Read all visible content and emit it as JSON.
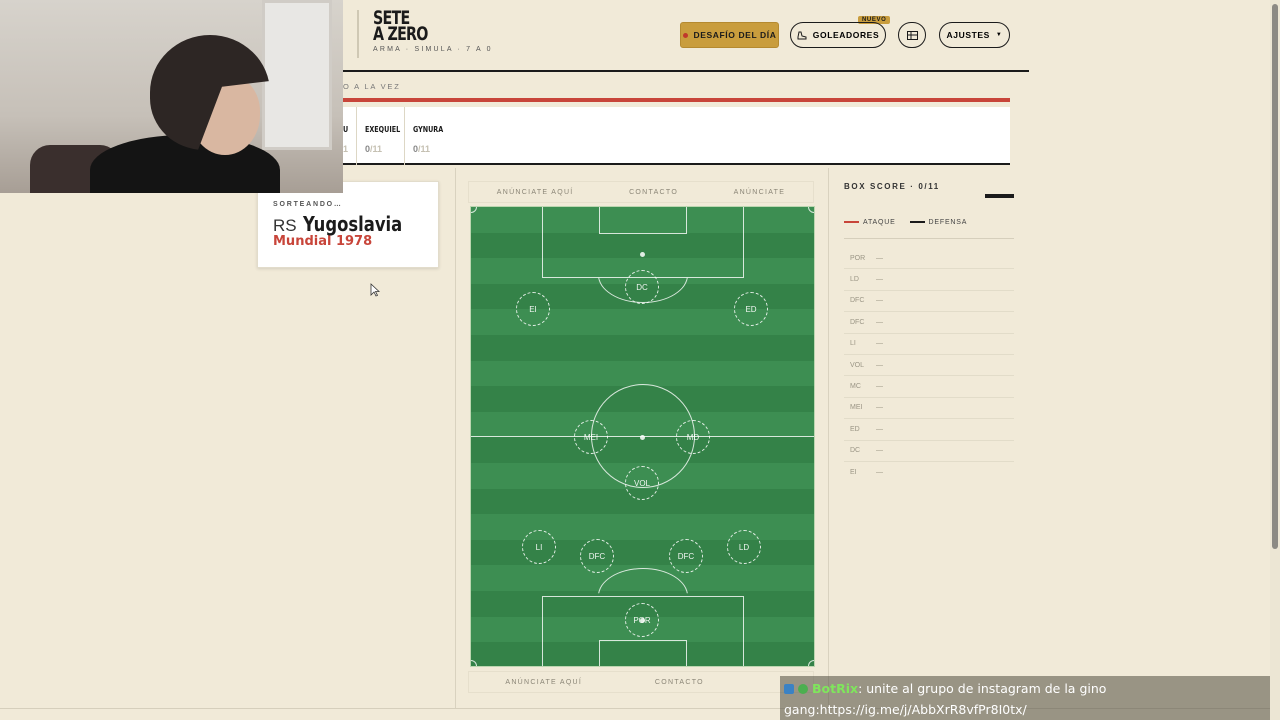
{
  "header": {
    "logo_title": "SETE A ZERO",
    "logo_line1": "SETE",
    "logo_line2": "A ZERO",
    "logo_sub": "ARMA · SIMULA · 7 A 0",
    "challenge_label": "DESAFÍO DEL DÍA",
    "scorers_label": "GOLEADORES",
    "new_badge": "NUEVO",
    "settings_label": "AJUSTES",
    "subtitle": "O A LA VEZ"
  },
  "players": [
    {
      "name": "U",
      "score": "",
      "total": "1"
    },
    {
      "name": "EXEQUIEL",
      "score": "0",
      "total": "/11"
    },
    {
      "name": "GYNURA",
      "score": "0",
      "total": "/11"
    }
  ],
  "draw": {
    "label": "SORTEANDO…",
    "code": "RS",
    "team": "Yugoslavia",
    "tournament": "Mundial 1978"
  },
  "ads": {
    "top": [
      "ANÚNCIATE AQUÍ",
      "CONTACTO",
      "ANÚNCIATE"
    ],
    "bottom": [
      "ANÚNCIATE AQUÍ",
      "CONTACTO",
      ""
    ]
  },
  "pitch_slots": [
    {
      "label": "DC"
    },
    {
      "label": "EI"
    },
    {
      "label": "ED"
    },
    {
      "label": "MEI"
    },
    {
      "label": "MD"
    },
    {
      "label": "VOL"
    },
    {
      "label": "LI"
    },
    {
      "label": "DFC"
    },
    {
      "label": "DFC"
    },
    {
      "label": "LD"
    },
    {
      "label": "POR"
    }
  ],
  "box_score": {
    "title": "BOX SCORE · 0/11",
    "legend_attack": "ATAQUE",
    "legend_defense": "DEFENSA",
    "attack_color": "#c8453a",
    "defense_color": "#1b1b1b",
    "rows": [
      {
        "pos": "POR",
        "value": "—"
      },
      {
        "pos": "LD",
        "value": "—"
      },
      {
        "pos": "DFC",
        "value": "—"
      },
      {
        "pos": "DFC",
        "value": "—"
      },
      {
        "pos": "LI",
        "value": "—"
      },
      {
        "pos": "VOL",
        "value": "—"
      },
      {
        "pos": "MC",
        "value": "—"
      },
      {
        "pos": "MEI",
        "value": "—"
      },
      {
        "pos": "ED",
        "value": "—"
      },
      {
        "pos": "DC",
        "value": "—"
      },
      {
        "pos": "EI",
        "value": "—"
      }
    ]
  },
  "chat": {
    "user": "BotRix",
    "message_line1": ": unite al grupo de instagram de la gino",
    "message_line2": "gang:https://ig.me/j/AbbXrR8vfPr8I0tx/"
  },
  "colors": {
    "background": "#f1ead8",
    "accent_red": "#c8453a",
    "gold": "#c99d3d",
    "pitch_green": "#3d8e52"
  }
}
